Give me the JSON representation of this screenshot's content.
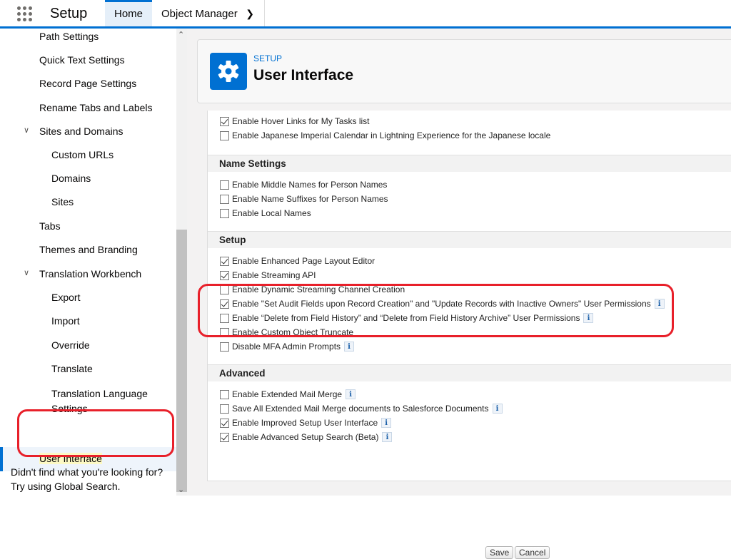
{
  "header": {
    "app_name": "Setup",
    "tabs": [
      {
        "label": "Home"
      },
      {
        "label": "Object Manager"
      }
    ]
  },
  "sidebar": {
    "items": [
      {
        "label": "Path Settings",
        "level": 1
      },
      {
        "label": "Quick Text Settings",
        "level": 1
      },
      {
        "label": "Record Page Settings",
        "level": 1
      },
      {
        "label": "Rename Tabs and Labels",
        "level": 1
      },
      {
        "label": "Sites and Domains",
        "level": 1,
        "expanded": true
      },
      {
        "label": "Custom URLs",
        "level": 2
      },
      {
        "label": "Domains",
        "level": 2
      },
      {
        "label": "Sites",
        "level": 2
      },
      {
        "label": "Tabs",
        "level": 1
      },
      {
        "label": "Themes and Branding",
        "level": 1
      },
      {
        "label": "Translation Workbench",
        "level": 1,
        "expanded": true
      },
      {
        "label": "Export",
        "level": 2
      },
      {
        "label": "Import",
        "level": 2
      },
      {
        "label": "Override",
        "level": 2
      },
      {
        "label": "Translate",
        "level": 2
      },
      {
        "label": "Translation Language Settings",
        "level": 2
      }
    ],
    "selected": "User Interface",
    "footer": "Didn't find what you're looking for? Try using Global Search."
  },
  "page": {
    "breadcrumb": "SETUP",
    "title": "User Interface"
  },
  "sections": [
    {
      "title": "",
      "rows": [
        {
          "label": "Enable Hover Links for My Tasks list",
          "checked": true,
          "info": false
        },
        {
          "label": "Enable Japanese Imperial Calendar in Lightning Experience for the Japanese locale",
          "checked": false,
          "info": false
        }
      ]
    },
    {
      "title": "Name Settings",
      "rows": [
        {
          "label": "Enable Middle Names for Person Names",
          "checked": false,
          "info": false
        },
        {
          "label": "Enable Name Suffixes for Person Names",
          "checked": false,
          "info": false
        },
        {
          "label": "Enable Local Names",
          "checked": false,
          "info": false
        }
      ]
    },
    {
      "title": "Setup",
      "rows": [
        {
          "label": "Enable Enhanced Page Layout Editor",
          "checked": true,
          "info": false
        },
        {
          "label": "Enable Streaming API",
          "checked": true,
          "info": false
        },
        {
          "label": "Enable Dynamic Streaming Channel Creation",
          "checked": false,
          "info": false
        },
        {
          "label": "Enable \"Set Audit Fields upon Record Creation\" and \"Update Records with Inactive Owners\" User Permissions",
          "checked": true,
          "info": true
        },
        {
          "label": "Enable “Delete from Field History” and “Delete from Field History Archive” User Permissions",
          "checked": false,
          "info": true
        },
        {
          "label": "Enable Custom Object Truncate",
          "checked": false,
          "info": false
        },
        {
          "label": "Disable MFA Admin Prompts",
          "checked": false,
          "info": true
        }
      ]
    },
    {
      "title": "Advanced",
      "rows": [
        {
          "label": "Enable Extended Mail Merge",
          "checked": false,
          "info": true
        },
        {
          "label": "Save All Extended Mail Merge documents to Salesforce Documents",
          "checked": false,
          "info": true
        },
        {
          "label": "Enable Improved Setup User Interface",
          "checked": true,
          "info": true
        },
        {
          "label": "Enable Advanced Setup Search (Beta)",
          "checked": true,
          "info": true
        }
      ]
    }
  ],
  "buttons": {
    "save": "Save",
    "cancel": "Cancel"
  },
  "info_glyph": "i",
  "colors": {
    "brand": "#0070d2",
    "annotation": "#e8202a"
  }
}
